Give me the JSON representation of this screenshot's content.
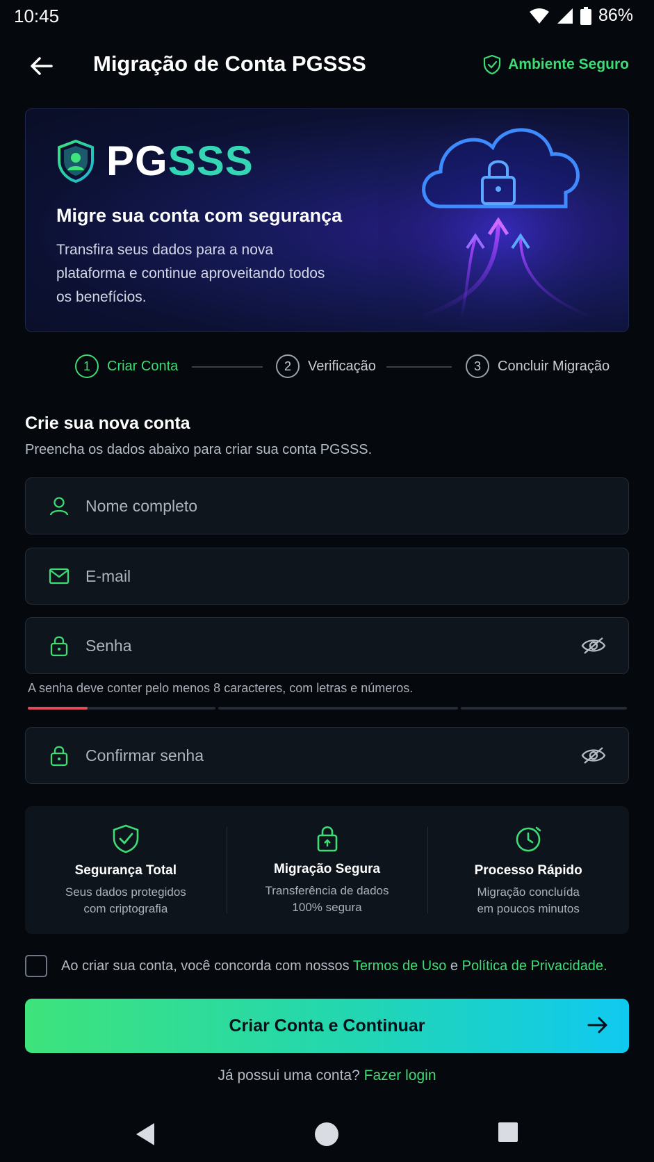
{
  "status_bar": {
    "time": "10:45",
    "battery": "86%"
  },
  "header": {
    "title": "Migração de Conta PGSSS",
    "secure_label": "Ambiente Seguro"
  },
  "banner": {
    "brand_pg": "PG",
    "brand_sss": "SSS",
    "heading": "Migre sua conta com segurança",
    "text": "Transfira seus dados para a nova plataforma e continue aproveitando todos os benefícios."
  },
  "stepper": {
    "steps": [
      {
        "number": "1",
        "label": "Criar Conta"
      },
      {
        "number": "2",
        "label": "Verificação"
      },
      {
        "number": "3",
        "label": "Concluir Migração"
      }
    ],
    "active_step": 1
  },
  "form": {
    "title": "Crie sua nova conta",
    "subtitle": "Preencha os dados abaixo para criar sua conta PGSSS.",
    "name_placeholder": "Nome completo",
    "email_placeholder": "E-mail",
    "password_placeholder": "Senha",
    "password_hint": "A senha deve conter pelo menos 8 caracteres, com letras e números.",
    "password_strength": 0.1,
    "confirm_placeholder": "Confirmar senha"
  },
  "features": [
    {
      "icon": "shield-check-icon",
      "title": "Segurança Total",
      "line1": "Seus dados protegidos",
      "line2": "com criptografia"
    },
    {
      "icon": "lock-icon",
      "title": "Migração Segura",
      "line1": "Transferência de dados",
      "line2": "100% segura"
    },
    {
      "icon": "clock-icon",
      "title": "Processo Rápido",
      "line1": "Migração concluída",
      "line2": "em poucos minutos"
    }
  ],
  "terms": {
    "prefix": "Ao criar sua conta, você concorda com nossos",
    "terms_link": "Termos de Uso",
    "conjunction": "e",
    "privacy_link": "Política de Privacidade",
    "suffix": "."
  },
  "cta": {
    "label": "Criar Conta e Continuar"
  },
  "login": {
    "prompt": "Já possui uma conta?",
    "link": "Fazer login"
  },
  "colors": {
    "accent": "#3ddc74",
    "brand_teal": "#35d6b4",
    "background": "#05080d"
  }
}
